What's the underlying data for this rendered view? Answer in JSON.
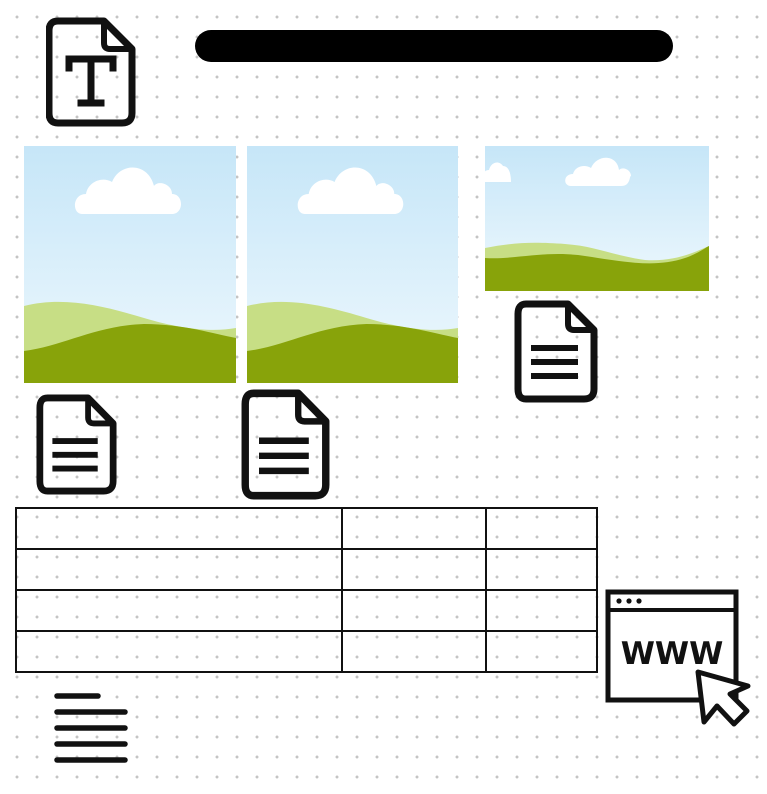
{
  "colors": {
    "stroke": "#111111",
    "sky_top": "#c6e6f8",
    "sky_bottom": "#eef8fd",
    "hill_light": "#c7de85",
    "hill_dark": "#88a30a",
    "cloud": "#ffffff"
  },
  "icons": {
    "header": "text-file-icon",
    "documents": [
      "document-icon",
      "document-icon",
      "document-icon"
    ],
    "hamburger": "text-lines-icon",
    "browser": "web-browser-icon",
    "pointer": "mouse-cursor-icon"
  },
  "browser": {
    "address_text": "WWW"
  },
  "table": {
    "columns": 3,
    "rows": [
      [
        "",
        "",
        ""
      ],
      [
        "",
        "",
        ""
      ],
      [
        "",
        "",
        ""
      ],
      [
        "",
        "",
        ""
      ]
    ]
  }
}
